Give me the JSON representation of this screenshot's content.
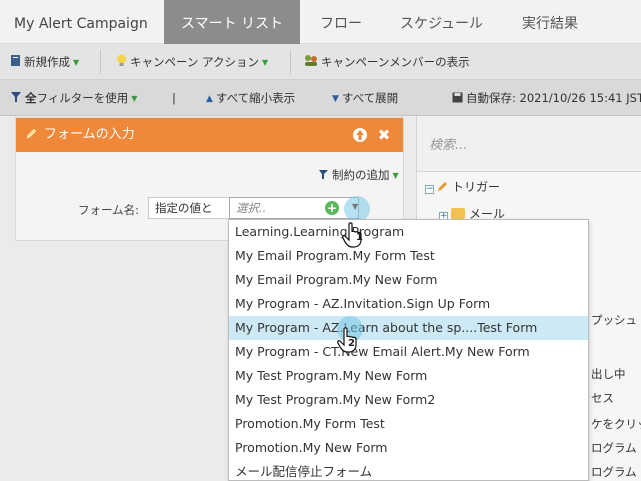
{
  "tabs": {
    "campaign": "My Alert Campaign",
    "smart_list": "スマート リスト",
    "flow": "フロー",
    "schedule": "スケジュール",
    "results": "実行結果"
  },
  "toolbar1": {
    "new": "新規作成",
    "campaign_action": "キャンペーン アクション",
    "show_members": "キャンペーンメンバーの表示"
  },
  "toolbar2": {
    "filter_use_prefix": "全",
    "filter_use": "フィルターを使用",
    "divider": "|",
    "collapse_all": "すべて縮小表示",
    "expand_all": "すべて展開",
    "autosave": "自動保存: 2021/10/26 15:41 JST"
  },
  "panel": {
    "title": "フォームの入力",
    "add_constraint": "制約の追加",
    "form_label": "フォーム名:",
    "operator": "指定の値と",
    "combo_placeholder": "選択.."
  },
  "dropdown": {
    "items": [
      "Learning.Learning Program",
      "My Email Program.My Form Test",
      "My Email Program.My New Form",
      "My Program - AZ.Invitation.Sign Up Form",
      "My Program - AZ.Learn about the sp....Test Form",
      "My Program - CT.New Email Alert.My New Form",
      "My Test Program.My New Form",
      "My Test Program.My New Form2",
      "Promotion.My Form Test",
      "Promotion.My New Form",
      "メール配信停止フォーム"
    ],
    "highlighted_index": 4
  },
  "right_panel": {
    "search_placeholder": "検索...",
    "trigger": "トリガー",
    "email": "メール",
    "peek_1": "プッシュ",
    "peek_2": "出し中",
    "peek_3": "セス",
    "peek_4": "ケをクリッ",
    "peek_5": "ログラム・",
    "peek_6": "ログラム・"
  },
  "cursors": {
    "step1": "1",
    "step2": "2"
  },
  "colors": {
    "accent": "#f0883a",
    "active_tab": "#8c8c8c",
    "highlight": "#cde9f6"
  }
}
